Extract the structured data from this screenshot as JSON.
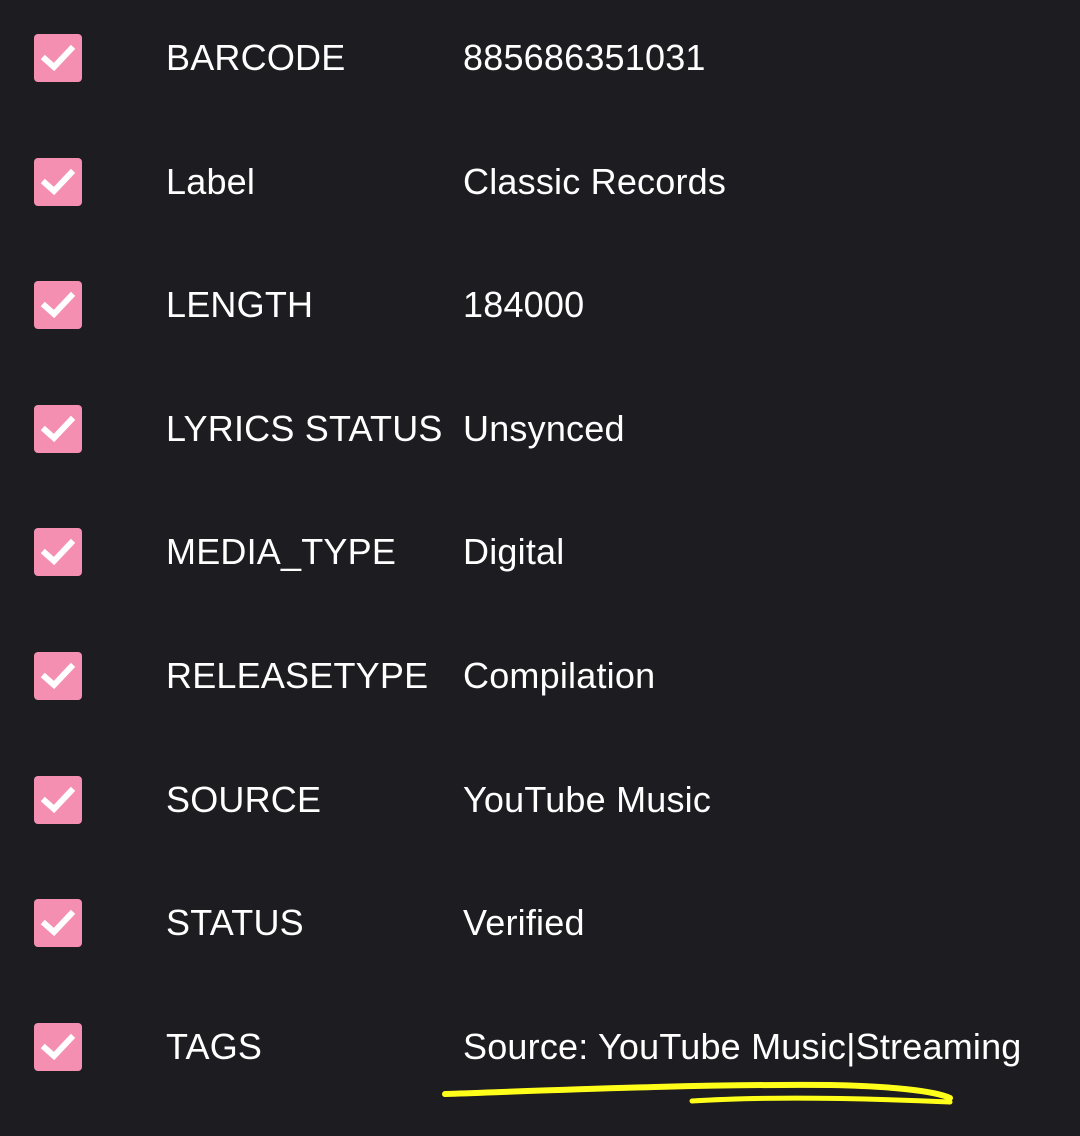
{
  "tags": [
    {
      "key": "BARCODE",
      "value": "885686351031",
      "checked": true
    },
    {
      "key": "Label",
      "value": "Classic Records",
      "checked": true
    },
    {
      "key": "LENGTH",
      "value": "184000",
      "checked": true
    },
    {
      "key": "LYRICS STATUS",
      "value": "Unsynced",
      "checked": true
    },
    {
      "key": "MEDIA_TYPE",
      "value": "Digital",
      "checked": true
    },
    {
      "key": "RELEASETYPE",
      "value": "Compilation",
      "checked": true
    },
    {
      "key": "SOURCE",
      "value": "YouTube Music",
      "checked": true
    },
    {
      "key": "STATUS",
      "value": "Verified",
      "checked": true
    },
    {
      "key": "TAGS",
      "value": "Source: YouTube Music|Streaming",
      "checked": true
    }
  ],
  "colors": {
    "background": "#1d1c21",
    "checkbox": "#f48fb1",
    "checkmark": "#ffffff",
    "text": "#ffffff",
    "highlight_underline": "#ffff1a"
  },
  "icons": {
    "checkbox": "check-icon"
  }
}
